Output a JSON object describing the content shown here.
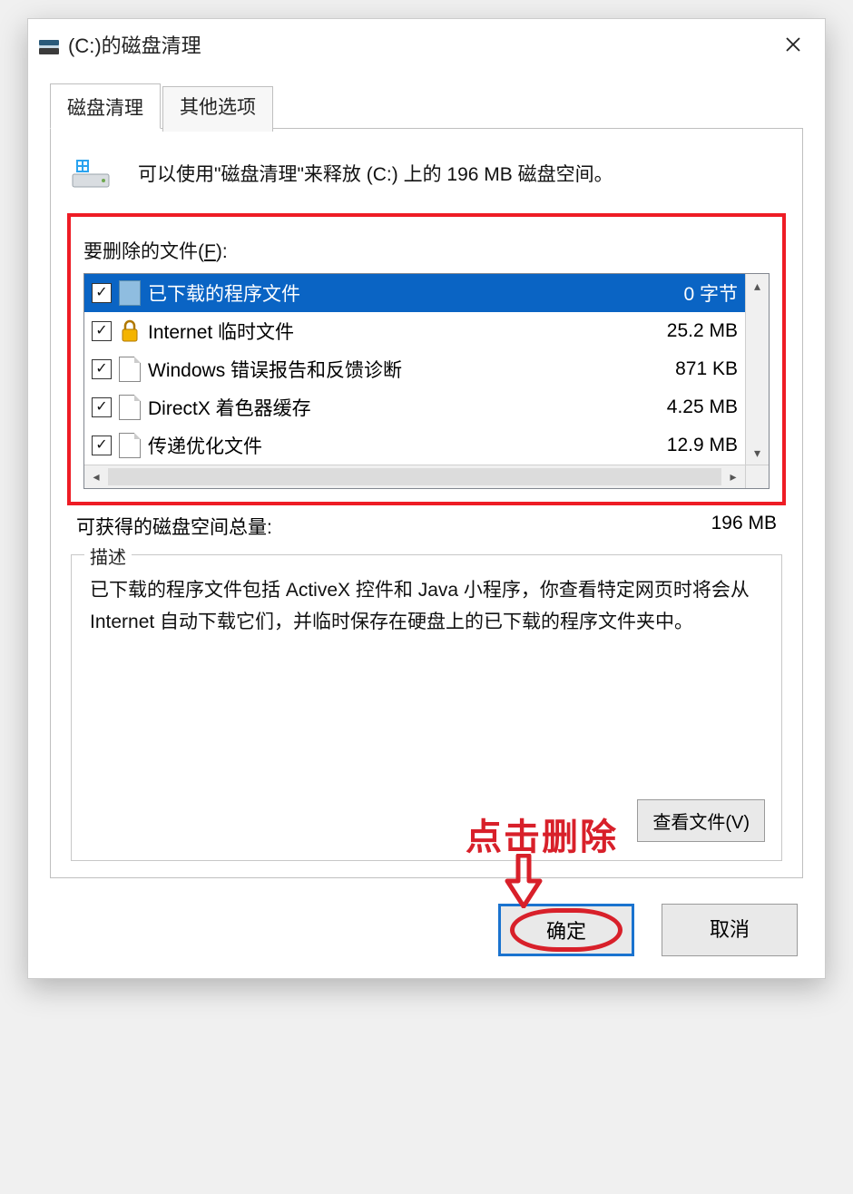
{
  "title": "(C:)的磁盘清理",
  "tabs": {
    "active": "磁盘清理",
    "other": "其他选项"
  },
  "summary": "可以使用\"磁盘清理\"来释放  (C:) 上的 196 MB 磁盘空间。",
  "filesLabel": "要删除的文件(",
  "filesLabelU": "F",
  "filesLabelEnd": "):",
  "items": [
    {
      "label": "已下载的程序文件",
      "size": "0 字节",
      "checked": true,
      "icon": "folder",
      "selected": true
    },
    {
      "label": "Internet 临时文件",
      "size": "25.2 MB",
      "checked": true,
      "icon": "lock",
      "selected": false
    },
    {
      "label": "Windows 错误报告和反馈诊断",
      "size": "871 KB",
      "checked": true,
      "icon": "doc",
      "selected": false
    },
    {
      "label": "DirectX 着色器缓存",
      "size": "4.25 MB",
      "checked": true,
      "icon": "doc",
      "selected": false
    },
    {
      "label": "传递优化文件",
      "size": "12.9 MB",
      "checked": true,
      "icon": "doc",
      "selected": false
    }
  ],
  "gain": {
    "label": "可获得的磁盘空间总量:",
    "value": "196 MB"
  },
  "group": {
    "legend": "描述",
    "text": "已下载的程序文件包括 ActiveX 控件和 Java 小程序，你查看特定网页时将会从 Internet 自动下载它们，并临时保存在硬盘上的已下载的程序文件夹中。",
    "viewBtn": "查看文件(V)"
  },
  "annotation": "点击删除",
  "buttons": {
    "ok": "确定",
    "cancel": "取消"
  }
}
